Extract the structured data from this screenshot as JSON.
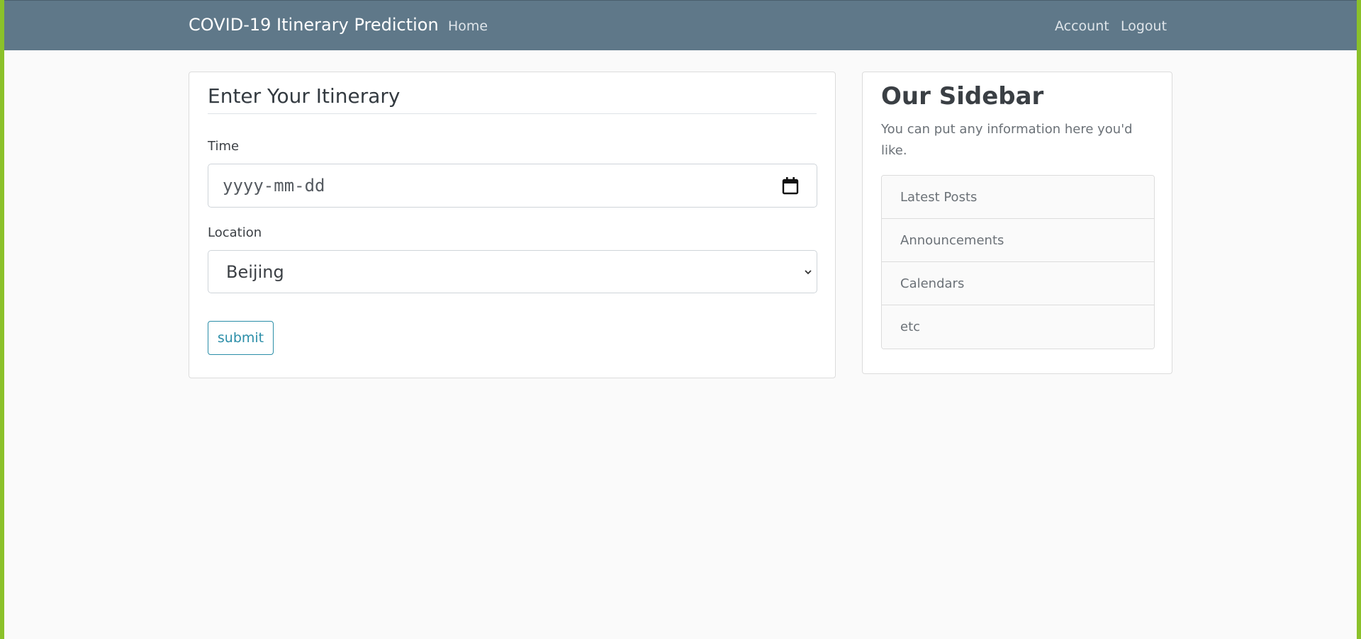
{
  "navbar": {
    "brand": "COVID-19 Itinerary Prediction",
    "home_label": "Home",
    "account_label": "Account",
    "logout_label": "Logout",
    "bg_color": "#5f7889"
  },
  "form": {
    "legend": "Enter Your Itinerary",
    "time_label": "Time",
    "time_placeholder": "yyyy-mm-dd",
    "location_label": "Location",
    "location_selected": "Beijing",
    "submit_label": "submit",
    "accent_color": "#2b8ea8"
  },
  "sidebar": {
    "title": "Our Sidebar",
    "description": "You can put any information here you'd like.",
    "items": [
      {
        "label": "Latest Posts"
      },
      {
        "label": "Announcements"
      },
      {
        "label": "Calendars"
      },
      {
        "label": "etc"
      }
    ]
  },
  "icons": {
    "date_picker": "calendar-icon",
    "select_toggle": "chevron-down-icon"
  },
  "frame_border_color": "#8bc12a"
}
